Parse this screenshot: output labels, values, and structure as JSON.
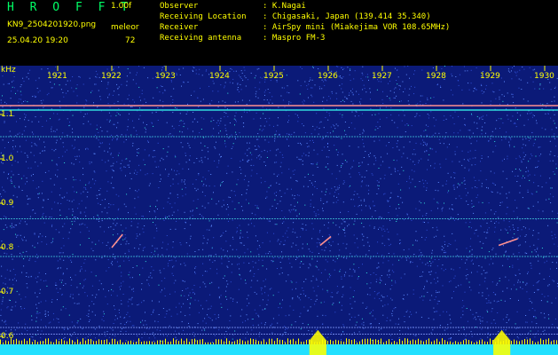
{
  "header": {
    "app_title": "H R O F F T",
    "version": "1.00f",
    "filename": "KN9_2504201920.png",
    "station": "meleor",
    "datetime": "25.04.20 19:20",
    "count": "72",
    "meta": [
      {
        "label": "Observer",
        "value": ": K.Nagai"
      },
      {
        "label": "Receiving Location",
        "value": ": Chigasaki, Japan (139.414 35.340)"
      },
      {
        "label": "Receiver",
        "value": ": AirSpy mini (Miakejima VOR 108.65MHz)"
      },
      {
        "label": "Receiving antenna",
        "value": ": Maspro FM-3"
      }
    ]
  },
  "chart_data": {
    "type": "heatmap",
    "ylabel": "kHz",
    "y_ticks": [
      "1.1",
      "1.0",
      "0.9",
      "0.8",
      "0.7",
      "0.6"
    ],
    "y_tick_values": [
      1.1,
      1.0,
      0.9,
      0.8,
      0.7,
      0.6
    ],
    "ylim": [
      0.57,
      1.19
    ],
    "x_ticks": [
      "1921",
      "1922",
      "1923",
      "1924",
      "1925",
      "1926",
      "1927",
      "1928",
      "1929",
      "1930"
    ],
    "x_tick_minutes": [
      21,
      22,
      23,
      24,
      25,
      26,
      27,
      28,
      29,
      30
    ],
    "xlim_minutes": [
      20.45,
      30.45
    ],
    "colors": {
      "background": "#0b1a78",
      "noise_light": "#5f8cff",
      "noise_cyan": "#33dddd",
      "carrier": "#d06070",
      "carrier_bright": "#ff9090",
      "level_bar": "#22e0ff",
      "peak": "#ffff00"
    },
    "carriers_khz": [
      1.12,
      1.11,
      1.05,
      0.865,
      0.78,
      0.62,
      0.605
    ],
    "echoes": [
      {
        "minute_start": 25.85,
        "minute_end": 26.05,
        "khz_start": 0.805,
        "khz_end": 0.825
      },
      {
        "minute_start": 29.15,
        "minute_end": 29.5,
        "khz_start": 0.805,
        "khz_end": 0.82
      },
      {
        "minute_start": 22.0,
        "minute_end": 22.2,
        "khz_start": 0.8,
        "khz_end": 0.83
      }
    ],
    "level_peaks_minutes": [
      25.8,
      29.2
    ]
  }
}
